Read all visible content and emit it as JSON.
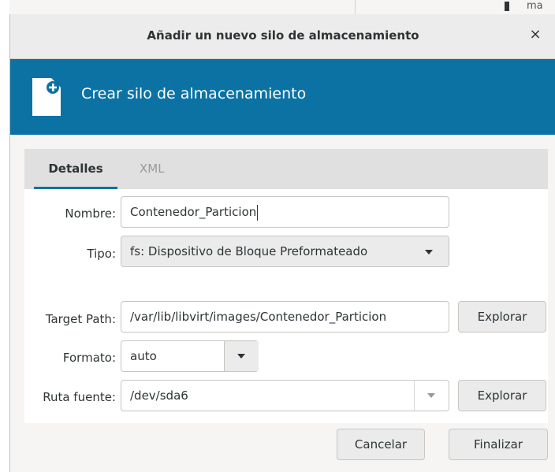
{
  "background": {
    "text": "ma"
  },
  "titlebar": {
    "title": "Añadir un nuevo silo de almacenamiento",
    "close_glyph": "×"
  },
  "header": {
    "title": "Crear silo de almacenamiento",
    "icon": "new-document-icon"
  },
  "tabs": [
    {
      "label": "Detalles",
      "active": true
    },
    {
      "label": "XML",
      "active": false
    }
  ],
  "form": {
    "name_label": "Nombre:",
    "name_value": "Contenedor_Particion",
    "type_label": "Tipo:",
    "type_value": "fs: Dispositivo de Bloque Preformateado",
    "target_label": "Target Path:",
    "target_value": "/var/lib/libvirt/images/Contenedor_Particion",
    "target_browse": "Explorar",
    "format_label": "Formato:",
    "format_value": "auto",
    "source_label": "Ruta fuente:",
    "source_value": "/dev/sda6",
    "source_browse": "Explorar"
  },
  "actions": {
    "cancel": "Cancelar",
    "finish": "Finalizar"
  },
  "colors": {
    "header_bg": "#0b72a3",
    "tab_accent": "#0b72a3"
  }
}
